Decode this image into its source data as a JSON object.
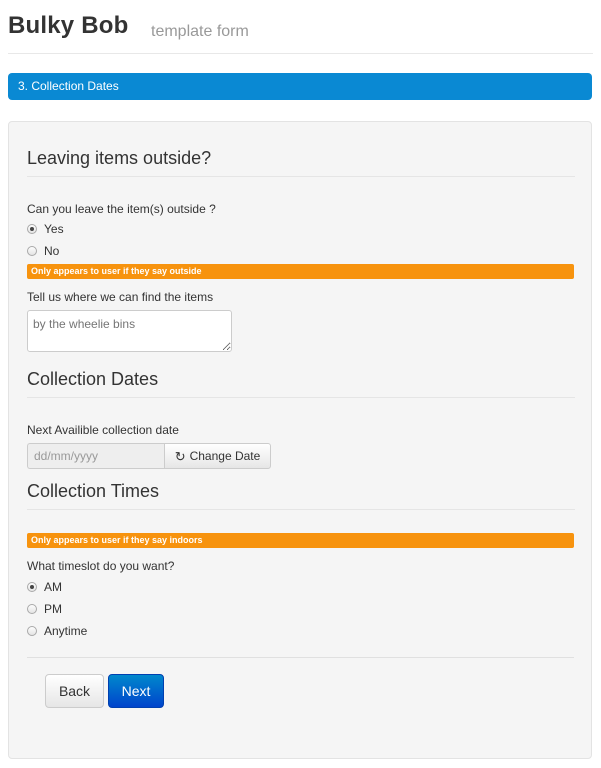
{
  "header": {
    "title": "Bulky Bob",
    "subtitle": "template form"
  },
  "step": {
    "label": "3. Collection Dates"
  },
  "sections": {
    "outside": {
      "legend": "Leaving items outside?",
      "question": "Can you leave the item(s) outside ?",
      "options": [
        {
          "label": "Yes",
          "checked": true
        },
        {
          "label": "No",
          "checked": false
        }
      ],
      "note": "Only appears to user if they say outside",
      "where_label": "Tell us where we can find the items",
      "where_placeholder": "by the wheelie bins"
    },
    "dates": {
      "legend": "Collection Dates",
      "date_label": "Next Availible collection date",
      "date_placeholder": "dd/mm/yyyy",
      "change_button": "Change Date",
      "change_icon": "refresh-icon"
    },
    "times": {
      "legend": "Collection Times",
      "note": "Only appears to user if they say indoors",
      "question": "What timeslot do you want?",
      "options": [
        {
          "label": "AM",
          "checked": true
        },
        {
          "label": "PM",
          "checked": false
        },
        {
          "label": "Anytime",
          "checked": false
        }
      ]
    }
  },
  "actions": {
    "back": "Back",
    "next": "Next"
  },
  "colors": {
    "step_bar": "#0a89d3",
    "note_bar": "#f7930e",
    "primary_button": "#0066cc"
  }
}
